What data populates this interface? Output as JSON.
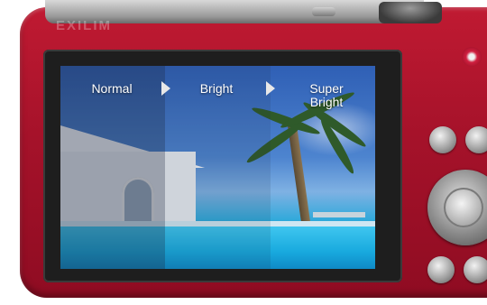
{
  "camera": {
    "brand": "EXILIM"
  },
  "screen": {
    "options": [
      {
        "label": "Normal"
      },
      {
        "label": "Bright"
      },
      {
        "label": "Super\nBright"
      }
    ]
  },
  "icons": [
    "arrow-right-icon",
    "arrow-right-icon"
  ],
  "colors": {
    "camera_body": "#a5122a",
    "label_text": "#ffffff"
  }
}
